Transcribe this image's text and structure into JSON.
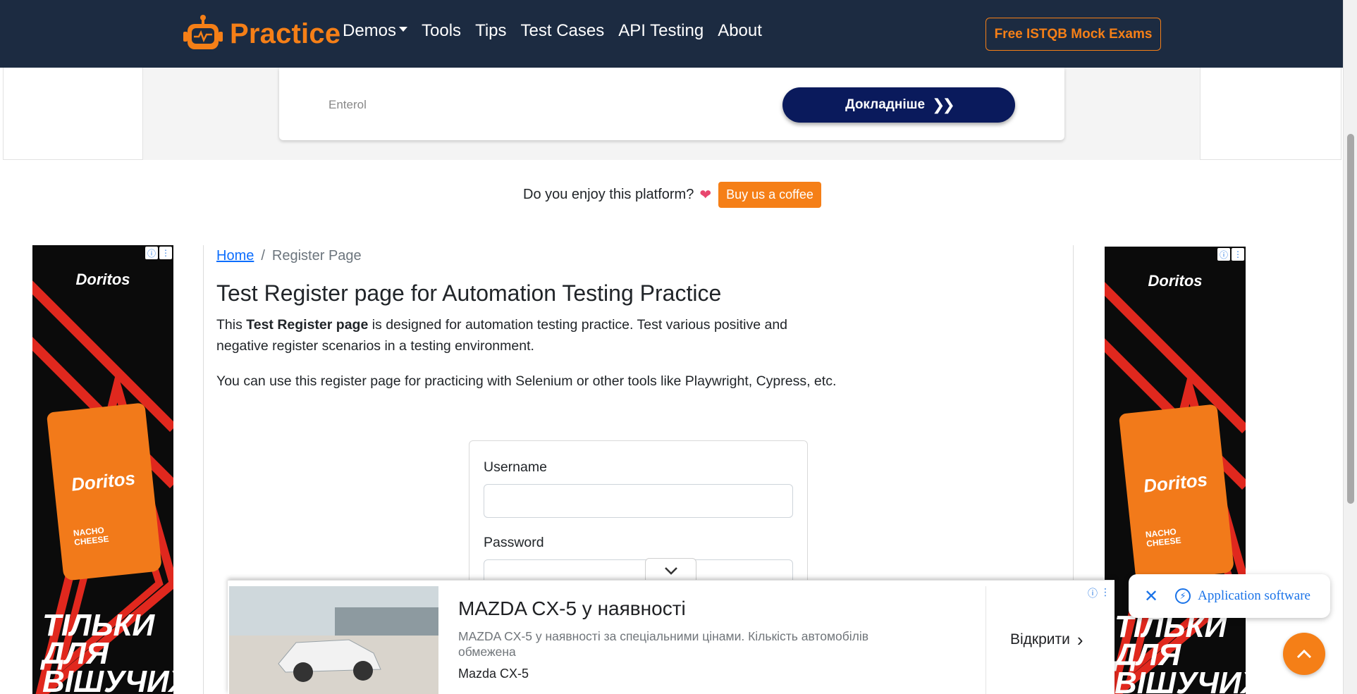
{
  "navbar": {
    "brand": "Practice",
    "links": [
      "Demos",
      "Tools",
      "Tips",
      "Test Cases",
      "API Testing",
      "About"
    ],
    "cta": "Free ISTQB Mock Exams"
  },
  "top_ad": {
    "advertiser": "Enterol",
    "button": "Докладніше"
  },
  "support": {
    "text": "Do you enjoy this platform?",
    "heart": "❤",
    "button": "Buy us a coffee"
  },
  "side_ads": {
    "logo": "Doritos",
    "bag_logo": "Doritos",
    "bag_line1": "NACHO",
    "bag_line2": "CHEESE",
    "tagline_line1": "ТІЛЬКИ",
    "tagline_line2": "ДЛЯ",
    "tagline_line3": "ВІШУЧИХ"
  },
  "breadcrumb": {
    "home": "Home",
    "separator": "/",
    "current": "Register Page"
  },
  "main": {
    "title": "Test Register page for Automation Testing Practice",
    "p1_before": "This ",
    "p1_bold": "Test Register page",
    "p1_after": " is designed for automation testing practice. Test various positive and negative register scenarios in a testing environment.",
    "p2": "You can use this register page for practicing with Selenium or other tools like Playwright, Cypress, etc."
  },
  "form": {
    "username_label": "Username",
    "username_value": "",
    "password_label": "Password",
    "password_value": ""
  },
  "bottom_ad": {
    "title": "MAZDA CX-5 у наявності",
    "description": "MAZDA CX-5 у наявності за спеціальними цінами. Кількість автомобілів обмежена",
    "subtitle": "Mazda CX-5",
    "cta": "Відкрити"
  },
  "app_pill": {
    "label": "Application software"
  },
  "icons": {
    "collapse": "chevron-down-icon",
    "close": "close-icon",
    "bolt": "bolt-icon",
    "to_top": "chevron-up-icon",
    "info": "info-icon",
    "more": "more-vert-icon"
  },
  "colors": {
    "navbar": "#1c2b41",
    "accent": "#f57f17",
    "link": "#0d6efd",
    "ad_button": "#0a1a5c",
    "pill_text": "#1a73e8"
  }
}
